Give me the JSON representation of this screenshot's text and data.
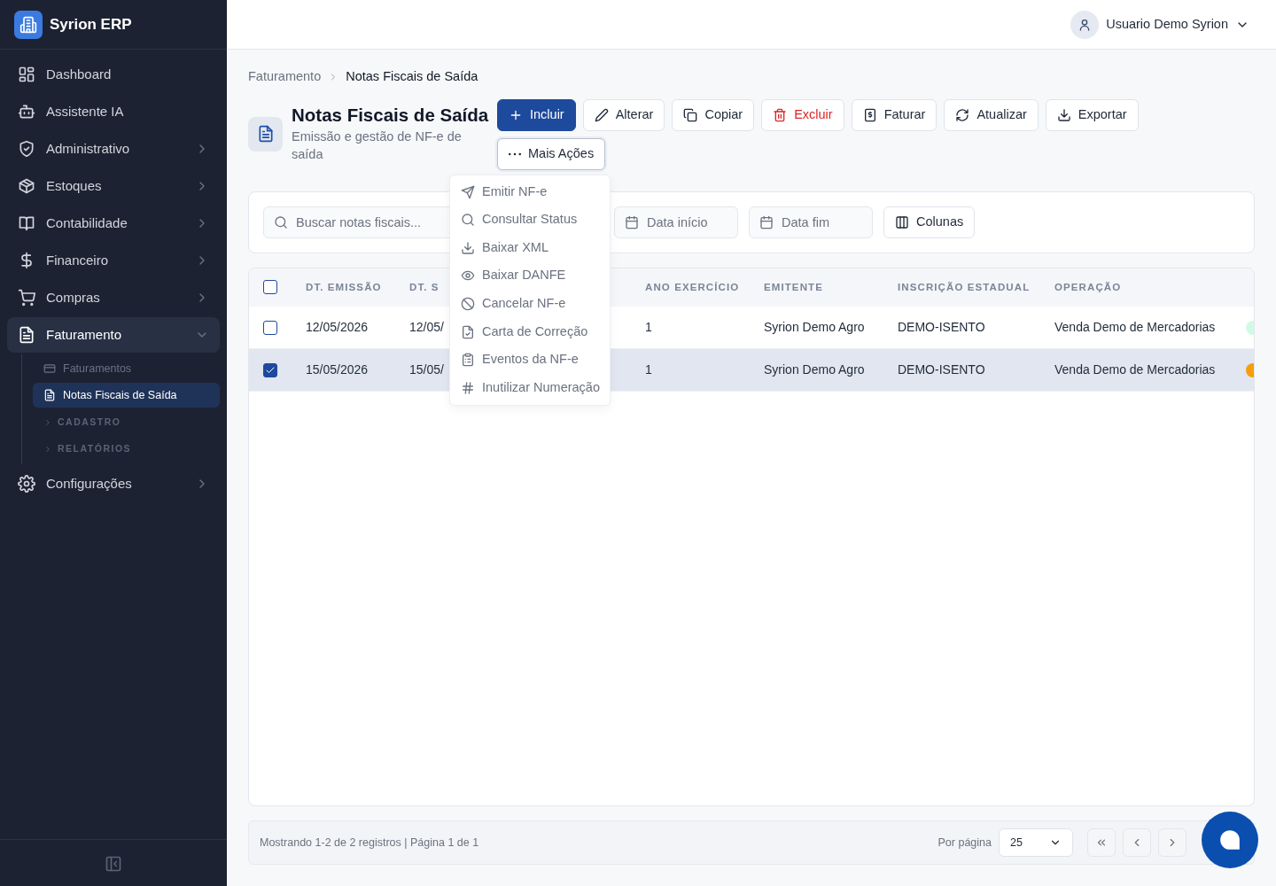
{
  "app": {
    "name": "Syrion ERP"
  },
  "sidebar": {
    "items": [
      {
        "label": "Dashboard",
        "kind": "link",
        "selected": false
      },
      {
        "label": "Assistente IA",
        "kind": "link",
        "selected": false
      },
      {
        "label": "Administrativo",
        "kind": "group",
        "expanded": false,
        "selected": false
      },
      {
        "label": "Estoques",
        "kind": "group",
        "expanded": false,
        "selected": false
      },
      {
        "label": "Contabilidade",
        "kind": "group",
        "expanded": false,
        "selected": false
      },
      {
        "label": "Financeiro",
        "kind": "group",
        "expanded": false,
        "selected": false
      },
      {
        "label": "Compras",
        "kind": "group",
        "expanded": false,
        "selected": false
      },
      {
        "label": "Faturamento",
        "kind": "group",
        "expanded": true,
        "selected": true,
        "children": [
          {
            "label": "Faturamentos",
            "kind": "link",
            "selected": false
          },
          {
            "label": "Notas Fiscais de Saída",
            "kind": "link",
            "selected": true
          },
          {
            "label": "CADASTRO",
            "kind": "section",
            "expanded": false
          },
          {
            "label": "RELATÓRIOS",
            "kind": "section",
            "expanded": false
          }
        ]
      },
      {
        "label": "Configurações",
        "kind": "group",
        "expanded": false,
        "selected": false
      }
    ]
  },
  "user": {
    "name": "Usuario Demo Syrion"
  },
  "breadcrumb": [
    {
      "label": "Faturamento",
      "current": false
    },
    {
      "label": "Notas Fiscais de Saída",
      "current": true
    }
  ],
  "page": {
    "title": "Notas Fiscais de Saída",
    "subtitle": "Emissão e gestão de NF-e de saída"
  },
  "toolbar": [
    {
      "label": "Incluir",
      "kind": "primary"
    },
    {
      "label": "Alterar",
      "kind": "default"
    },
    {
      "label": "Copiar",
      "kind": "default"
    },
    {
      "label": "Excluir",
      "kind": "danger"
    },
    {
      "label": "Faturar",
      "kind": "default"
    },
    {
      "label": "Atualizar",
      "kind": "default"
    },
    {
      "label": "Exportar",
      "kind": "default"
    },
    {
      "label": "Mais Ações",
      "kind": "menu",
      "expanded": true
    }
  ],
  "actions_menu": [
    "Emitir NF-e",
    "Consultar Status",
    "Baixar XML",
    "Baixar DANFE",
    "Cancelar NF-e",
    "Carta de Correção",
    "Eventos da NF-e",
    "Inutilizar Numeração"
  ],
  "filters": {
    "search": {
      "placeholder": "Buscar notas fiscais..."
    },
    "date_start": {
      "placeholder": "Data início"
    },
    "date_end": {
      "placeholder": "Data fim"
    },
    "columns_button": "Colunas"
  },
  "table": {
    "select_all": {
      "checked": false
    },
    "columns": [
      "DT. EMISSÃO",
      "DT. S",
      "ANO EXERCÍCIO",
      "EMITENTE",
      "INSCRIÇÃO ESTADUAL",
      "OPERAÇÃO"
    ],
    "rows": [
      {
        "selected": false,
        "cells": [
          "12/05/2026",
          "12/05/",
          "1",
          "Syrion Demo Agro",
          "DEMO-ISENTO",
          "Venda Demo de Mercadorias"
        ],
        "color": "#d1fae5"
      },
      {
        "selected": true,
        "cells": [
          "15/05/2026",
          "15/05/",
          "1",
          "Syrion Demo Agro",
          "DEMO-ISENTO",
          "Venda Demo de Mercadorias"
        ],
        "color": "#f59e0b"
      }
    ]
  },
  "footer": {
    "summary": "Mostrando 1-2 de 2 registros | Página 1 de 1",
    "page_size_label": "Por página",
    "page_size": "25"
  }
}
